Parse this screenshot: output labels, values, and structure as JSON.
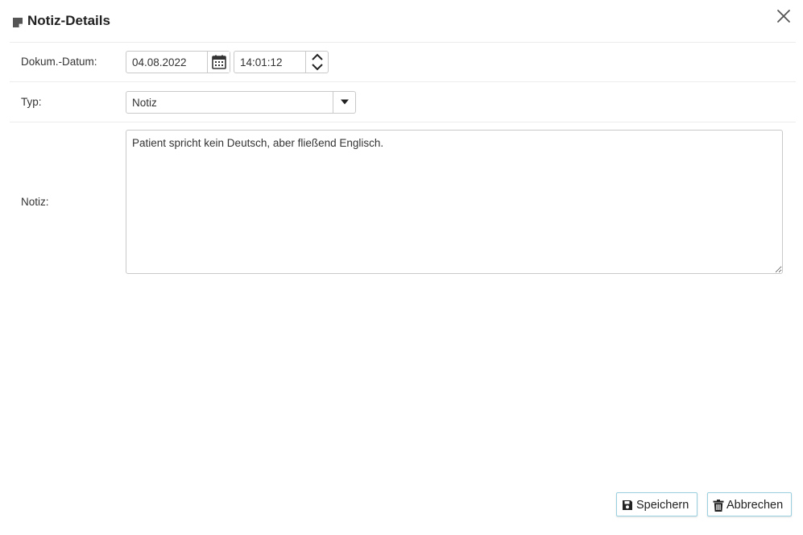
{
  "dialog": {
    "title": "Notiz-Details",
    "title_icon": "note-icon",
    "close_icon": "close-icon"
  },
  "form": {
    "date_label": "Dokum.-Datum:",
    "date_value": "04.08.2022",
    "time_value": "14:01:12",
    "type_label": "Typ:",
    "type_value": "Notiz",
    "note_label": "Notiz:",
    "note_value": "Patient spricht kein Deutsch, aber fließend Englisch."
  },
  "actions": {
    "save_label": "Speichern",
    "cancel_label": "Abbrechen"
  },
  "colors": {
    "button_border": "#9ad0df",
    "input_border": "#c9c9c9",
    "separator": "#ececec"
  }
}
